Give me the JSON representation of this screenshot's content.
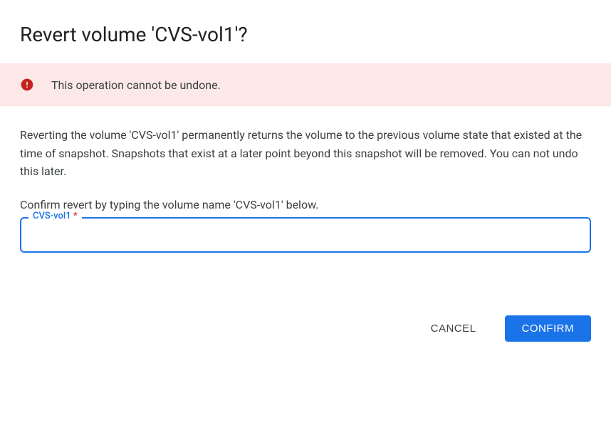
{
  "dialog": {
    "title": "Revert volume 'CVS-vol1'?",
    "warning": {
      "text": "This operation cannot be undone."
    },
    "description": "Reverting the volume 'CVS-vol1' permanently returns the volume to the previous volume state that existed at the time of snapshot. Snapshots that exist at a later point beyond this snapshot will be removed. You can not undo this later.",
    "confirm_prompt": "Confirm revert by typing the volume name 'CVS-vol1' below.",
    "input": {
      "label": "CVS-vol1",
      "required_mark": "*",
      "value": ""
    },
    "actions": {
      "cancel_label": "Cancel",
      "confirm_label": "Confirm"
    }
  }
}
